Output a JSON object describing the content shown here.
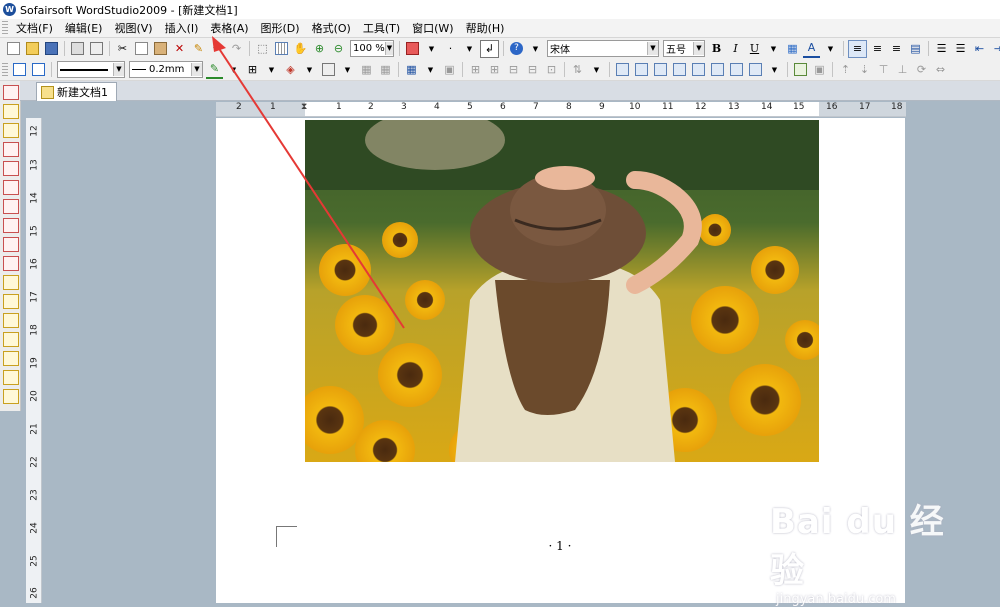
{
  "window": {
    "title": "Sofairsoft WordStudio2009 - [新建文档1]"
  },
  "menu": {
    "items": [
      "文档(F)",
      "编辑(E)",
      "视图(V)",
      "插入(I)",
      "表格(A)",
      "图形(D)",
      "格式(O)",
      "工具(T)",
      "窗口(W)",
      "帮助(H)"
    ]
  },
  "toolbar1": {
    "zoom": "100 %",
    "font_name": "宋体",
    "font_size": "五号",
    "bold": "B",
    "italic": "I",
    "underline": "U"
  },
  "toolbar2": {
    "line_width": "0.2mm"
  },
  "doc_tab": {
    "label": "新建文档1"
  },
  "ruler_h": {
    "labels": [
      "2",
      "1",
      "1",
      "1",
      "2",
      "3",
      "4",
      "5",
      "6",
      "7",
      "8",
      "9",
      "10",
      "11",
      "12",
      "13",
      "14",
      "15",
      "16",
      "17",
      "18"
    ]
  },
  "ruler_v": {
    "labels": [
      "12",
      "13",
      "14",
      "15",
      "16",
      "17",
      "18",
      "19",
      "20",
      "21",
      "22",
      "23",
      "24",
      "25",
      "26"
    ]
  },
  "page": {
    "page_number": "· 1 ·"
  },
  "watermark": {
    "brand": "Bai du 经验",
    "url": "jingyan.baidu.com"
  },
  "colors": {
    "annotation_arrow": "#e53935",
    "workspace": "#a9b8c5"
  }
}
